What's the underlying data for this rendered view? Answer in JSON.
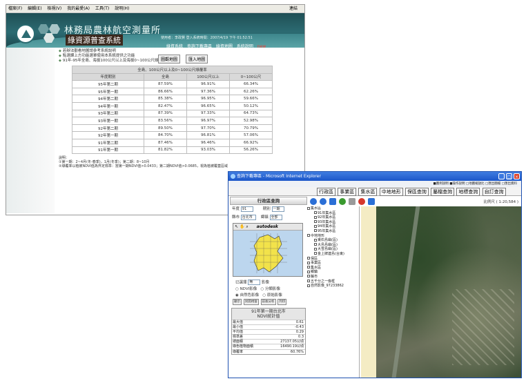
{
  "win1": {
    "menu": [
      "檔案(F)",
      "編輯(E)",
      "檢視(V)",
      "我的最愛(A)",
      "工具(T)",
      "說明(H)"
    ],
    "menu_right": "連結",
    "agency": "林務局農林航空測量所",
    "system": "綠資源普查系統",
    "userinfo": "使用者：李政賢 登入系統時間：2007/4/19 下午 01:52:51",
    "topnav": [
      "綠資系統",
      "查詢下載專區",
      "綠資地圖",
      "系統說明"
    ],
    "topnav_new": "new",
    "bullets": [
      "若辦法觀看地圖請參考系統說明",
      "點選課上方功能選單使用本系統提供之功能",
      "91年-95年全島、海拔100公尺以上及海拔0~100公尺綠覆率"
    ],
    "buttons": [
      "圖觀地圖",
      "匯入地圖"
    ],
    "table": {
      "group_header": "全島、100公尺以上及0~100公尺綠覆率",
      "headers": [
        "年度期別",
        "全島",
        "100公尺以上",
        "0~100公尺"
      ],
      "rows": [
        [
          "95年第二期",
          "87.59%",
          "96.91%",
          "66.34%"
        ],
        [
          "95年第一期",
          "86.66%",
          "97.36%",
          "62.26%"
        ],
        [
          "94年第二期",
          "85.38%",
          "96.95%",
          "59.66%"
        ],
        [
          "94年第一期",
          "82.47%",
          "96.65%",
          "50.12%"
        ],
        [
          "93年第二期",
          "87.39%",
          "97.33%",
          "64.73%"
        ],
        [
          "93年第一期",
          "83.56%",
          "96.97%",
          "52.98%"
        ],
        [
          "92年第二期",
          "89.50%",
          "97.70%",
          "70.79%"
        ],
        [
          "92年第一期",
          "84.70%",
          "96.81%",
          "57.06%"
        ],
        [
          "91年第二期",
          "87.46%",
          "96.46%",
          "66.92%"
        ],
        [
          "91年第一期",
          "81.82%",
          "93.03%",
          "56.26%"
        ]
      ]
    },
    "notes": [
      "說明：",
      "①第一期：2~4月(冬-春季)，1月(冬季)；第二期：8~10月",
      "②綠覆率以植被NDVI值為界定標準：當第一期NDVI值>0.0433；第二期NDVI值>0.0685，視為植被覆蓋區域"
    ]
  },
  "win2": {
    "title": "查詢下載專區 - Microsoft Internet Explorer",
    "links": "■圖例說明 ■操作說明 □地圖縮放比 □匯出圖檔 □匯出資料",
    "tabs": [
      "行政區",
      "事業區",
      "集水區",
      "中地地形",
      "保區查詢",
      "屬檔查詢",
      "地標查詢",
      "自訂查詢"
    ],
    "panel_title": "行政區查詢",
    "form": {
      "year_label": "年度",
      "year_value": "91",
      "period_label": "期別",
      "period_value": "一期",
      "city_label": "縣市",
      "city_value": "台北市",
      "town_label": "鄉鎮",
      "town_value": "全部"
    },
    "map_brand": "autodesk",
    "select_label": "已選擇",
    "select_value": "無",
    "image_label": "影像",
    "radio_ndvi": "NDVI影像",
    "radio_class": "分類影像",
    "radio_natural": "自然色影像",
    "radio_original": "原始影像",
    "small_buttons": [
      "顯示",
      "另開視窗",
      "前後分析",
      "列印"
    ],
    "stat_title": "91年第一期台北市",
    "stat_subtitle": "NDVI統計值",
    "stats": [
      {
        "label": "最大值",
        "value": "0.61"
      },
      {
        "label": "最小值",
        "value": "-0.43"
      },
      {
        "label": "平均值",
        "value": "0.29"
      },
      {
        "label": "標準差",
        "value": "0.3"
      },
      {
        "label": "總面積",
        "value": "27137.05公頃"
      },
      {
        "label": "綠色植物面積",
        "value": "16490.19公頃"
      },
      {
        "label": "綠覆率",
        "value": "60.76%"
      }
    ],
    "scale_text": "比例尺 ( 1:20,584 )",
    "layers": [
      "集水區",
      "91年集水區",
      "92年集水區",
      "93年集水區",
      "94年集水區",
      "95年集水區",
      "中地地形",
      "東石島嶼(區)",
      "大島島嶼(區)",
      "大雪島嶼(區)",
      "金上牌連島(台東)",
      "保區",
      "事業區",
      "集水區",
      "鄉鎮",
      "縣市",
      "五千分之一像框",
      "自然影像_97233862"
    ],
    "colors": {
      "titlebar": "#1b56c9",
      "tool_blue": "#2b6fd6",
      "tool_green": "#3a9a2f",
      "tool_red": "#d6372b"
    }
  }
}
